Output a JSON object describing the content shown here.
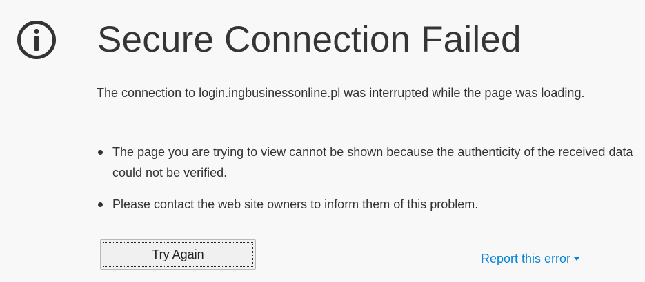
{
  "error": {
    "icon": "info-icon",
    "title": "Secure Connection Failed",
    "message": "The connection to login.ingbusinessonline.pl was interrupted while the page was loading.",
    "bullets": [
      "The page you are trying to view cannot be shown because the authenticity of the received data could not be verified.",
      "Please contact the web site owners to inform them of this problem."
    ]
  },
  "actions": {
    "try_again_label": "Try Again",
    "report_label": "Report this error",
    "report_icon": "caret-down-icon"
  },
  "colors": {
    "background": "#f8f8f8",
    "text": "#333333",
    "link": "#0a84d6"
  }
}
